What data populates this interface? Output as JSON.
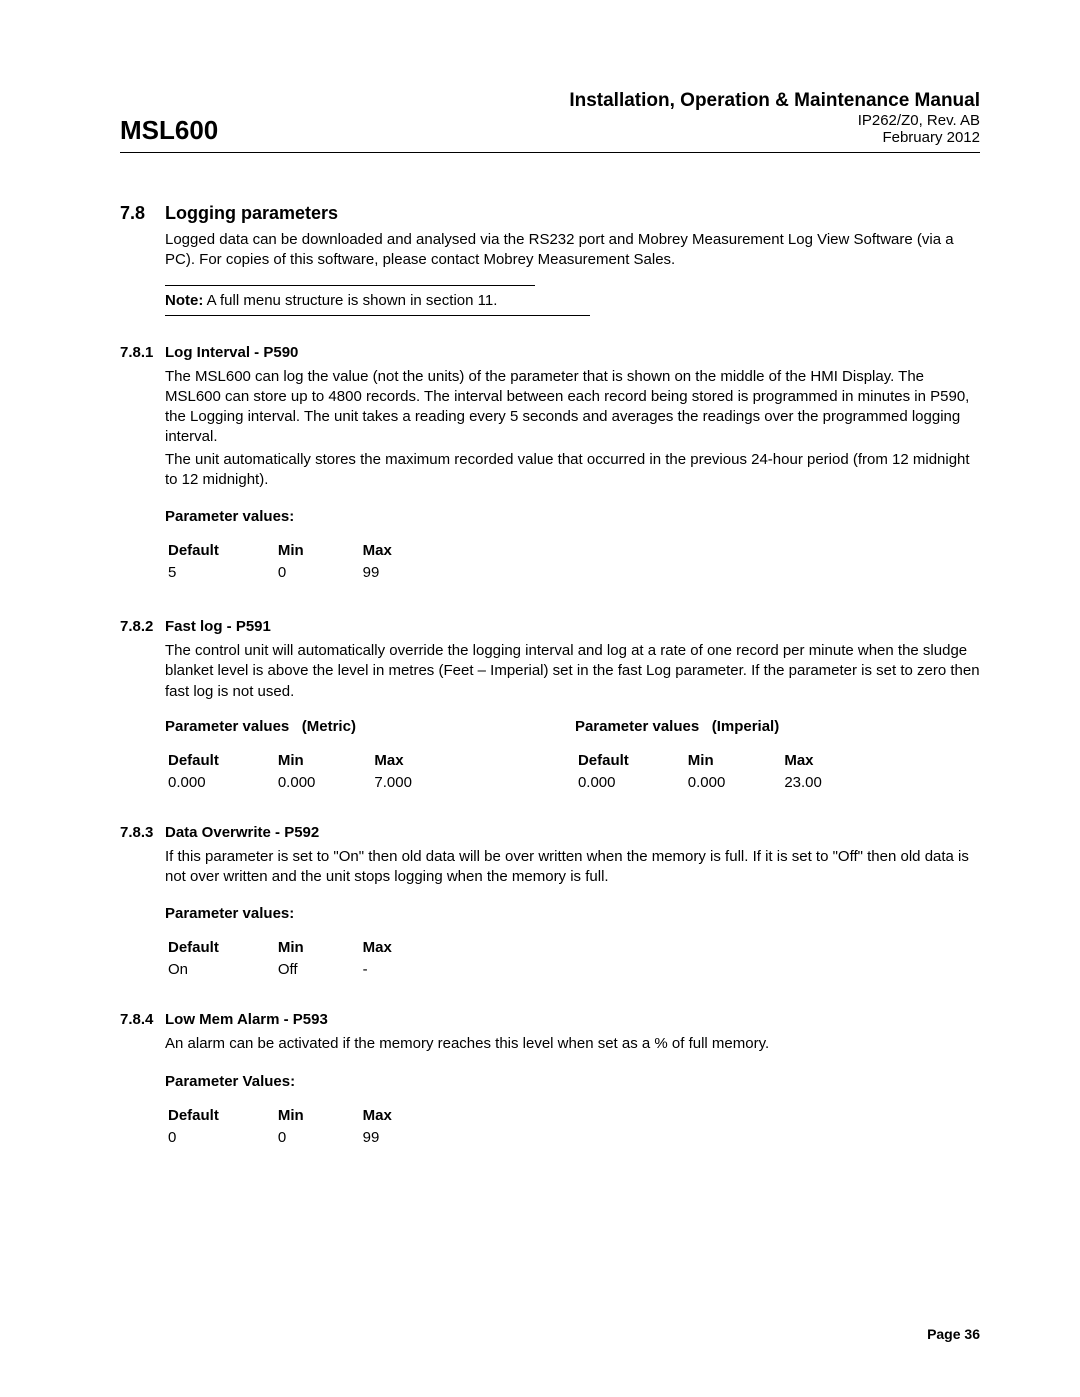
{
  "header": {
    "model": "MSL600",
    "manual_title": "Installation, Operation & Maintenance Manual",
    "doc_ref": "IP262/Z0, Rev. AB",
    "doc_date": "February 2012"
  },
  "section": {
    "number": "7.8",
    "title": "Logging parameters",
    "intro": "Logged data can be downloaded and analysed via the RS232 port and Mobrey Measurement Log View Software (via a PC).  For copies of this software, please contact Mobrey Measurement Sales.",
    "note_label": "Note:",
    "note_text": "A full menu structure is shown in section 11."
  },
  "s781": {
    "num": "7.8.1",
    "title": "Log Interval - P590",
    "body1": "The MSL600 can log the value (not the units) of the parameter that is shown on the middle of the HMI Display. The MSL600 can store up to 4800 records. The interval between each record being stored is programmed in minutes in P590, the Logging interval. The unit takes a reading every 5 seconds and averages the readings over the programmed logging interval.",
    "body2": "The unit automatically stores the maximum recorded value that occurred in the previous 24-hour period (from 12 midnight to 12 midnight).",
    "pv_label": "Parameter values:",
    "cols": {
      "c1": "Default",
      "c2": "Min",
      "c3": "Max"
    },
    "vals": {
      "v1": "5",
      "v2": "0",
      "v3": "99"
    }
  },
  "s782": {
    "num": "7.8.2",
    "title": "Fast log - P591",
    "body": "The control unit will automatically override the logging interval and log at a rate of one record per minute when the sludge blanket level is above the level in metres (Feet – Imperial) set in the fast Log parameter.  If the parameter is set to zero then fast log is not used.",
    "left_label": "Parameter values",
    "left_units": "(Metric)",
    "right_label": "Parameter values",
    "right_units": "(Imperial)",
    "cols": {
      "c1": "Default",
      "c2": "Min",
      "c3": "Max"
    },
    "metric": {
      "v1": "0.000",
      "v2": "0.000",
      "v3": "7.000"
    },
    "imperial": {
      "v1": "0.000",
      "v2": "0.000",
      "v3": "23.00"
    }
  },
  "s783": {
    "num": "7.8.3",
    "title": "Data Overwrite - P592",
    "body": "If this parameter is set to \"On\" then old data will be over written when the memory is full. If it is set to \"Off\" then old data is not over written and the unit stops logging when the memory is full.",
    "pv_label": "Parameter values:",
    "cols": {
      "c1": "Default",
      "c2": "Min",
      "c3": "Max"
    },
    "vals": {
      "v1": "On",
      "v2": "Off",
      "v3": "-"
    }
  },
  "s784": {
    "num": "7.8.4",
    "title": "Low Mem Alarm - P593",
    "body": "An alarm can be activated if the memory reaches this level when set as a % of full memory.",
    "pv_label": "Parameter Values:",
    "cols": {
      "c1": "Default",
      "c2": "Min",
      "c3": "Max"
    },
    "vals": {
      "v1": "0",
      "v2": "0",
      "v3": "99"
    }
  },
  "footer": {
    "page": "Page 36"
  }
}
